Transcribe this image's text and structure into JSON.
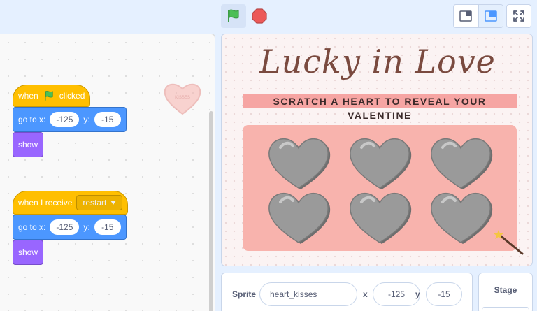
{
  "code": {
    "script1": {
      "hat": {
        "when_label": "when",
        "clicked_label": "clicked"
      },
      "goto": {
        "label": "go to x:",
        "x": "-125",
        "y_label": "y:",
        "y": "-15"
      },
      "show": {
        "label": "show"
      }
    },
    "script2": {
      "hat": {
        "label": "when I receive",
        "message": "restart"
      },
      "goto": {
        "label": "go to x:",
        "x": "-125",
        "y_label": "y:",
        "y": "-15"
      },
      "show": {
        "label": "show"
      }
    },
    "sprite_thumbnail_text": "KISSES"
  },
  "stage": {
    "title": "Lucky in Love",
    "subtitle": "SCRATCH A HEART TO REVEAL YOUR VALENTINE",
    "heart_count": 6
  },
  "sprite_info": {
    "sprite_label": "Sprite",
    "name": "heart_kisses",
    "x_label": "x",
    "x": "-125",
    "y_label": "y",
    "y": "-15"
  },
  "stage_panel": {
    "label": "Stage"
  },
  "colors": {
    "events": "#ffbf00",
    "motion": "#4c97ff",
    "looks": "#9966ff",
    "flag": "#4cbf56",
    "stop": "#ec5959",
    "heart_panel": "#f8b3ad"
  }
}
